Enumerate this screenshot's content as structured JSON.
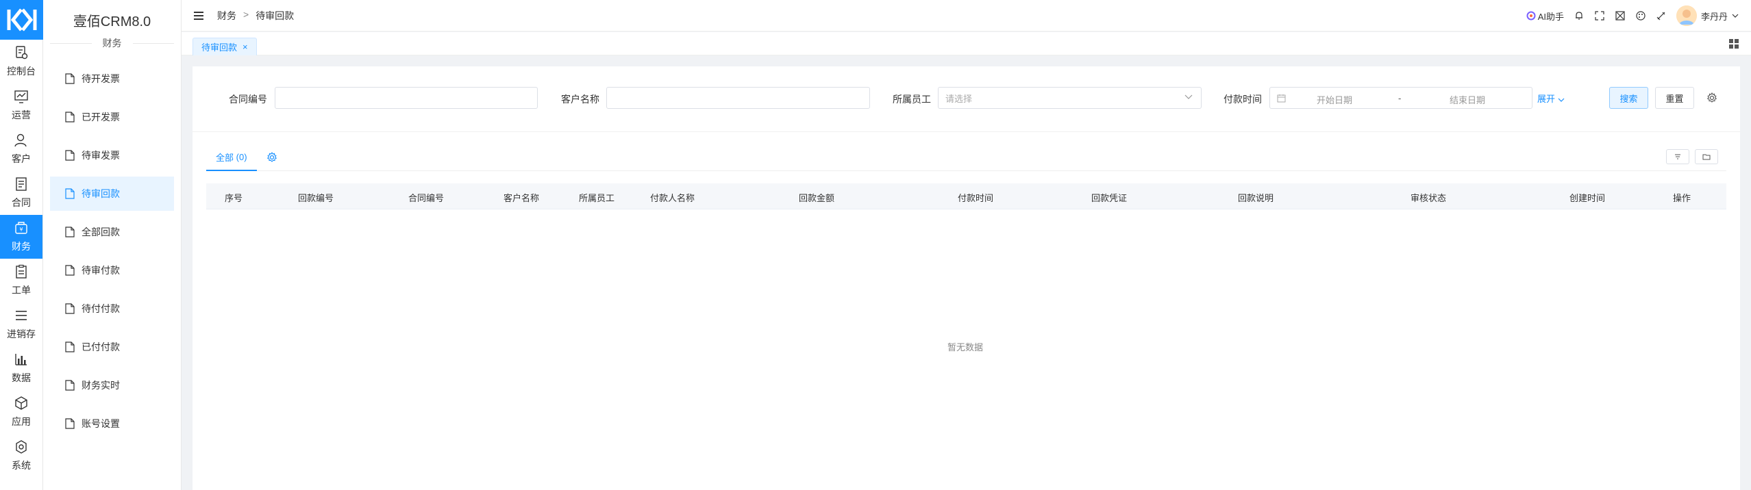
{
  "app": {
    "brand": "壹佰CRM8.0",
    "colors": {
      "primary": "#1890ff",
      "primary_light": "#e8f4ff"
    }
  },
  "rail": {
    "items": [
      {
        "label": "控制台",
        "icon": "dashboard-icon"
      },
      {
        "label": "运营",
        "icon": "chart-icon"
      },
      {
        "label": "客户",
        "icon": "user-icon"
      },
      {
        "label": "合同",
        "icon": "contract-icon"
      },
      {
        "label": "财务",
        "icon": "finance-icon",
        "active": true
      },
      {
        "label": "工单",
        "icon": "ticket-icon"
      },
      {
        "label": "进销存",
        "icon": "list-icon"
      },
      {
        "label": "数据",
        "icon": "data-icon"
      },
      {
        "label": "应用",
        "icon": "cube-icon"
      },
      {
        "label": "系统",
        "icon": "settings-icon"
      }
    ]
  },
  "subnav": {
    "section": "财务",
    "items": [
      {
        "label": "待开发票"
      },
      {
        "label": "已开发票"
      },
      {
        "label": "待审发票"
      },
      {
        "label": "待审回款",
        "active": true
      },
      {
        "label": "全部回款"
      },
      {
        "label": "待审付款"
      },
      {
        "label": "待付付款"
      },
      {
        "label": "已付付款"
      },
      {
        "label": "财务实时"
      },
      {
        "label": "账号设置"
      }
    ]
  },
  "header": {
    "breadcrumb": [
      "财务",
      "待审回款"
    ],
    "breadcrumb_sep": ">",
    "ai_label": "AI助手",
    "user_name": "李丹丹"
  },
  "tabs": {
    "active_label": "待审回款",
    "close_glyph": "×"
  },
  "filters": {
    "contract_no_label": "合同编号",
    "contract_no_value": "",
    "customer_label": "客户名称",
    "customer_value": "",
    "staff_label": "所属员工",
    "staff_placeholder": "请选择",
    "pay_time_label": "付款时间",
    "start_placeholder": "开始日期",
    "end_placeholder": "结束日期",
    "range_sep": "-",
    "expand_label": "展开",
    "search_label": "搜索",
    "reset_label": "重置"
  },
  "list": {
    "tab_label": "全部",
    "tab_count": "(0)",
    "columns": [
      "序号",
      "回款编号",
      "合同编号",
      "客户名称",
      "所属员工",
      "付款人名称",
      "回款金额",
      "付款时间",
      "回款凭证",
      "回款说明",
      "审核状态",
      "创建时间",
      "操作"
    ],
    "rows": [],
    "empty_text": "暂无数据"
  }
}
